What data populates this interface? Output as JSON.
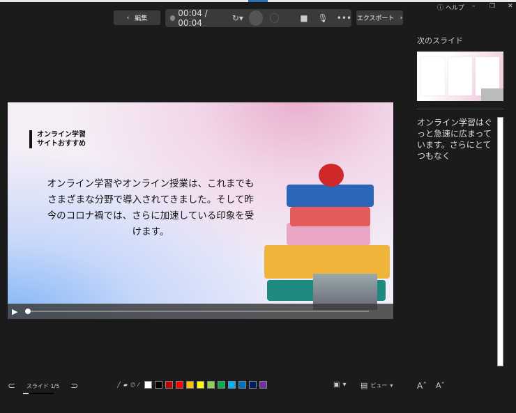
{
  "toolbar": {
    "edit_label": "編集",
    "time": "00:04 / 00:04",
    "export_label": "エクスポート"
  },
  "window": {
    "help_label": "ヘルプ"
  },
  "slide": {
    "title_lines": [
      "オンライン学習",
      "サイトおすすめ"
    ],
    "body": "オンライン学習やオンライン授業は、これまでもさまざまな分野で導入されてきました。そして昨今のコロナ禍では、さらに加速している印象を受けます。"
  },
  "sidebar": {
    "next_label": "次のスライド",
    "notes": "オンライン学習はぐっと急速に広まっています。さらにとてつもなく"
  },
  "footer": {
    "slide_counter": "スライド 1/5",
    "view_label": "ビュー"
  },
  "colors": [
    "#ffffff",
    "#000000",
    "#c00000",
    "#ff0000",
    "#ffc000",
    "#ffff00",
    "#92d050",
    "#00b050",
    "#00b0f0",
    "#0070c0",
    "#002060",
    "#7030a0"
  ]
}
